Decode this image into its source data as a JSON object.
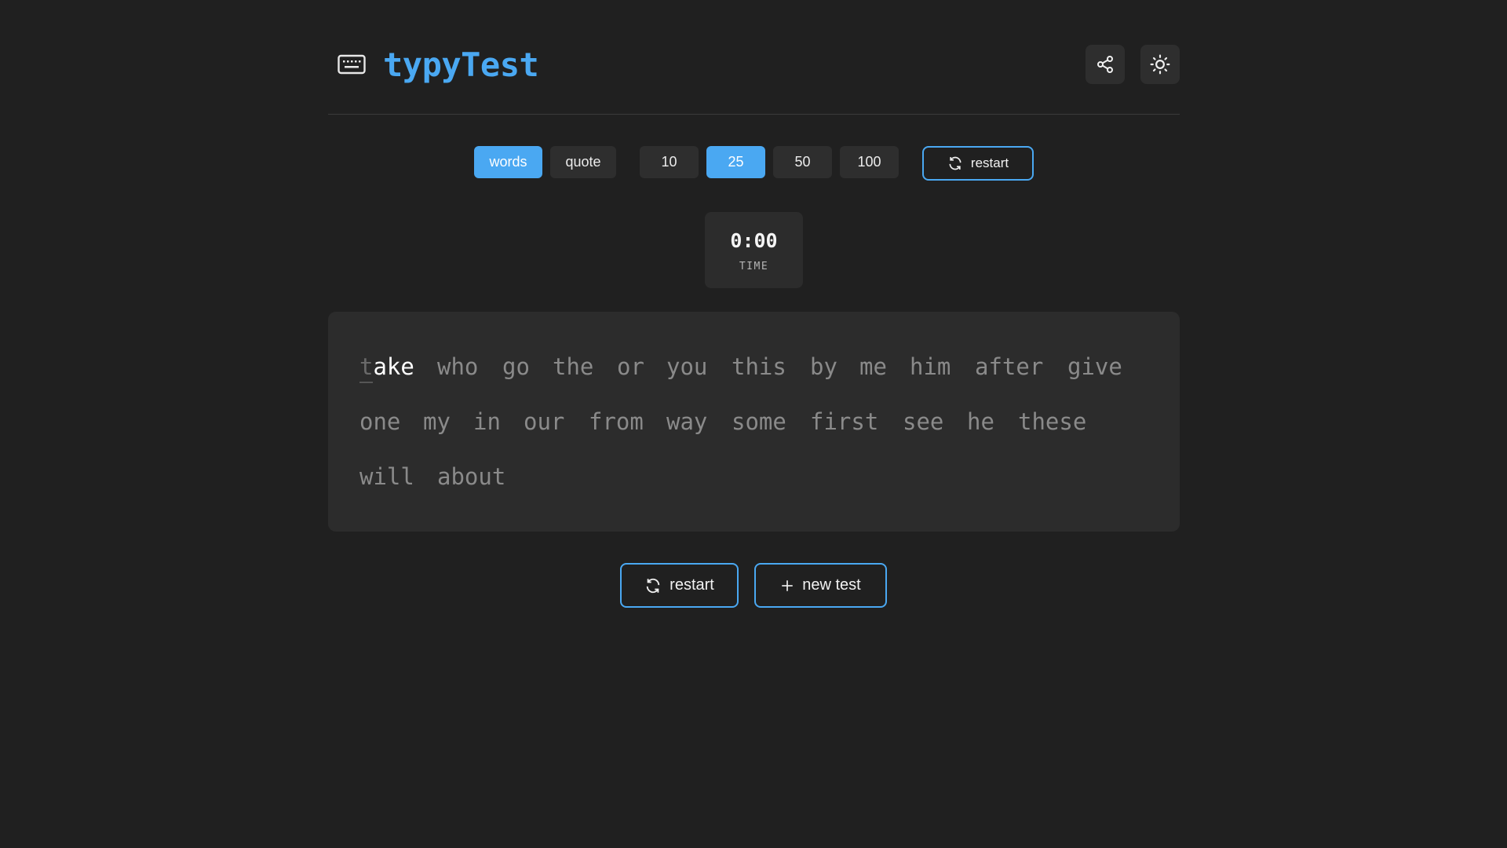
{
  "header": {
    "title": "typyTest",
    "logo_icon": "keyboard-icon",
    "share_icon": "share-icon",
    "theme_icon": "sun-icon"
  },
  "modes": {
    "types": [
      {
        "label": "words",
        "active": true
      },
      {
        "label": "quote",
        "active": false
      }
    ],
    "counts": [
      {
        "label": "10",
        "active": false
      },
      {
        "label": "25",
        "active": true
      },
      {
        "label": "50",
        "active": false
      },
      {
        "label": "100",
        "active": false
      }
    ],
    "restart_label": "restart"
  },
  "timer": {
    "value": "0:00",
    "label": "TIME"
  },
  "test": {
    "first_word_typed": "t",
    "first_word_rest": "ake",
    "words": [
      "who",
      "go",
      "the",
      "or",
      "you",
      "this",
      "by",
      "me",
      "him",
      "after",
      "give",
      "one",
      "my",
      "in",
      "our",
      "from",
      "way",
      "some",
      "first",
      "see",
      "he",
      "these",
      "will",
      "about"
    ]
  },
  "actions": {
    "restart_label": "restart",
    "new_test_label": "new test"
  },
  "colors": {
    "accent": "#4aa8f2",
    "background": "#202020",
    "panel": "#2c2c2c"
  }
}
